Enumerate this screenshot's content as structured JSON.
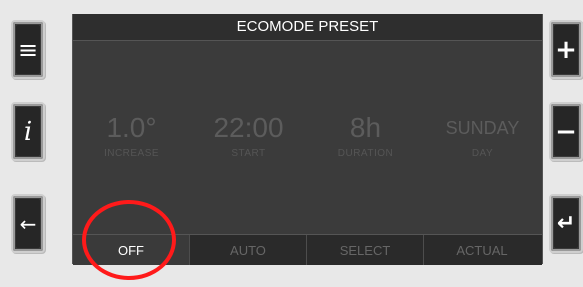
{
  "screen": {
    "title": "ECOMODE PRESET",
    "values": [
      {
        "value": "1.0°",
        "label": "INCREASE"
      },
      {
        "value": "22:00",
        "label": "START"
      },
      {
        "value": "8h",
        "label": "DURATION"
      },
      {
        "value": "SUNDAY",
        "label": "DAY"
      }
    ],
    "tabs": [
      {
        "label": "OFF"
      },
      {
        "label": "AUTO"
      },
      {
        "label": "SELECT"
      },
      {
        "label": "ACTUAL"
      }
    ]
  },
  "buttons": {
    "menu": "≡",
    "info": "i",
    "back": "←",
    "plus": "+",
    "minus": "−",
    "enter": "↵"
  },
  "colors": {
    "highlight": "#ff1a1a",
    "screen_bg": "#3b3b3b"
  }
}
